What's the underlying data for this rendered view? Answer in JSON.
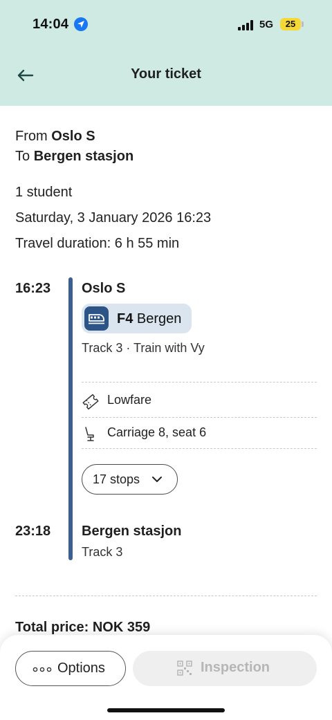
{
  "status_bar": {
    "time": "14:04",
    "network": "5G",
    "battery": "25"
  },
  "nav": {
    "title": "Your ticket"
  },
  "journey": {
    "from_label": "From",
    "from_station": "Oslo S",
    "to_label": "To",
    "to_station": "Bergen stasjon",
    "travellers": "1 student",
    "datetime": "Saturday, 3 January 2026 16:23",
    "duration": "Travel duration: 6 h 55 min"
  },
  "leg": {
    "departure_time": "16:23",
    "departure_station": "Oslo S",
    "line_code": "F4",
    "line_destination": "Bergen",
    "track_operator": "Track 3 · Train with Vy",
    "fare": "Lowfare",
    "seat": "Carriage 8, seat 6",
    "stops_label": "17 stops",
    "arrival_time": "23:18",
    "arrival_station": "Bergen stasjon",
    "arrival_track": "Track 3"
  },
  "price": {
    "total": "Total price: NOK 359"
  },
  "actions": {
    "options_label": "Options",
    "inspection_label": "Inspection"
  },
  "colors": {
    "header_bg": "#cfe9e3",
    "route_line": "#3b5e93",
    "chip_bg": "#dbe5ef",
    "chip_icon_bg": "#2c5487",
    "battery": "#f5d735"
  },
  "icons": [
    "location-arrow-icon",
    "signal-icon",
    "battery-icon",
    "back-arrow-icon",
    "train-icon",
    "ticket-icon",
    "seat-icon",
    "chevron-down-icon",
    "more-dots-icon",
    "qr-code-icon"
  ]
}
